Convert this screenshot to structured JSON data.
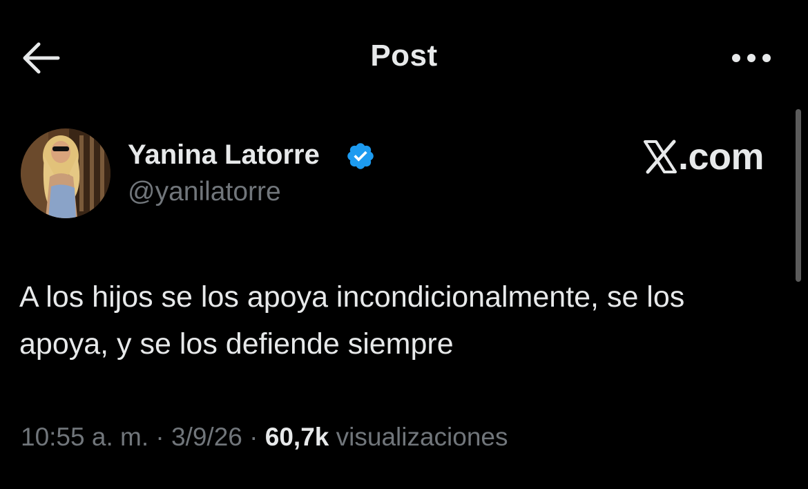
{
  "header": {
    "title": "Post",
    "back_icon": "arrow-left-icon",
    "more_icon": "more-horizontal-icon"
  },
  "author": {
    "name": "Yanina Latorre",
    "handle": "@yanilatorre",
    "verified": true,
    "verified_color": "#1d9bf0"
  },
  "watermark": {
    "text": ".com",
    "logo_icon": "x-logo-icon"
  },
  "post": {
    "text": "A los hijos se los apoya incondicionalmente, se los apoya, y se los defiende siempre"
  },
  "meta": {
    "time": "10:55 a. m.",
    "separator": "·",
    "date": "3/9/26",
    "views_count": "60,7k",
    "views_label": "visualizaciones"
  },
  "colors": {
    "background": "#000000",
    "primary_text": "#e7e9ea",
    "secondary_text": "#71767b",
    "accent": "#1d9bf0"
  }
}
